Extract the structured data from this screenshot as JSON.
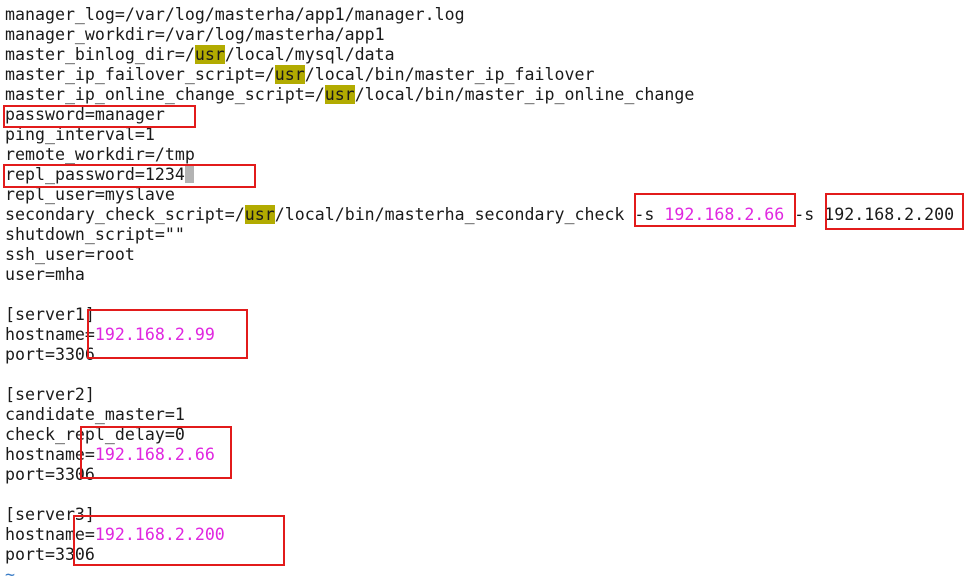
{
  "lines": [
    {
      "type": "plain",
      "text": "manager_log=/var/log/masterha/app1/manager.log"
    },
    {
      "type": "plain",
      "text": "manager_workdir=/var/log/masterha/app1"
    },
    {
      "type": "usr",
      "pre": "master_binlog_dir=/",
      "usr": "usr",
      "post": "/local/mysql/data"
    },
    {
      "type": "usr",
      "pre": "master_ip_failover_script=/",
      "usr": "usr",
      "post": "/local/bin/master_ip_failover"
    },
    {
      "type": "usr",
      "pre": "master_ip_online_change_script=/",
      "usr": "usr",
      "post": "/local/bin/master_ip_online_change"
    },
    {
      "type": "plain",
      "text": "password=manager"
    },
    {
      "type": "plain",
      "text": "ping_interval=1"
    },
    {
      "type": "plain",
      "text": "remote_workdir=/tmp"
    },
    {
      "type": "cursor",
      "text": "repl_password=1234"
    },
    {
      "type": "plain",
      "text": "repl_user=myslave"
    },
    {
      "type": "secondary",
      "pre": "secondary_check_script=/",
      "usr": "usr",
      "mid": "/local/bin/masterha_secondary_check -s ",
      "ip1": "192.168.2.66",
      "mid2": " -s ",
      "ip2": "192.168.2.200"
    },
    {
      "type": "plain",
      "text": "shutdown_script=\"\""
    },
    {
      "type": "plain",
      "text": "ssh_user=root"
    },
    {
      "type": "plain",
      "text": "user=mha"
    },
    {
      "type": "plain",
      "text": ""
    },
    {
      "type": "plain",
      "text": "[server1]"
    },
    {
      "type": "ip",
      "pre": "hostname=",
      "ip": "192.168.2.99"
    },
    {
      "type": "plain",
      "text": "port=3306"
    },
    {
      "type": "plain",
      "text": ""
    },
    {
      "type": "plain",
      "text": "[server2]"
    },
    {
      "type": "plain",
      "text": "candidate_master=1"
    },
    {
      "type": "plain",
      "text": "check_repl_delay=0"
    },
    {
      "type": "ip",
      "pre": "hostname=",
      "ip": "192.168.2.66"
    },
    {
      "type": "plain",
      "text": "port=3306"
    },
    {
      "type": "plain",
      "text": ""
    },
    {
      "type": "plain",
      "text": "[server3]"
    },
    {
      "type": "ip",
      "pre": "hostname=",
      "ip": "192.168.2.200"
    },
    {
      "type": "plain",
      "text": "port=3306"
    },
    {
      "type": "tilde",
      "text": "~"
    }
  ],
  "highlight_boxes": [
    "password-line",
    "repl-password-line",
    "secondary-check-first-ip",
    "secondary-check-second-ip",
    "server1-hostname",
    "server2-hostname",
    "server3-hostname"
  ],
  "colors": {
    "background": "#ffffff",
    "text": "#1a1a1a",
    "usr_highlight": "#b2ab00",
    "ip_text": "#e027e0",
    "annotation_box": "#e21b1b",
    "tilde": "#3a7cc6"
  }
}
